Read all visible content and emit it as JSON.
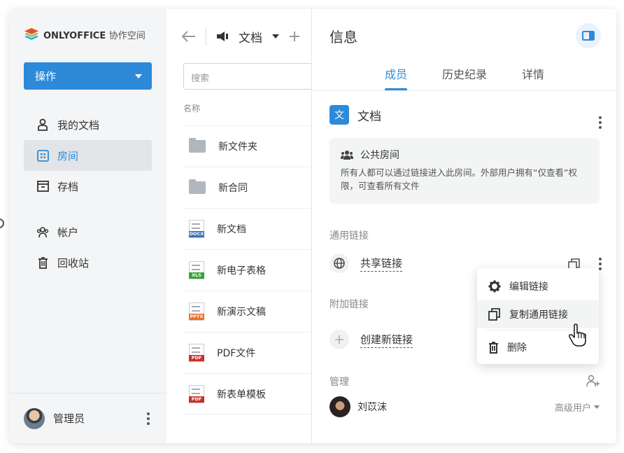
{
  "logo": {
    "brand": "ONLYOFFICE",
    "product": "协作空间"
  },
  "sidebar": {
    "action_label": "操作",
    "items": [
      {
        "label": "我的文档",
        "icon": "person-icon"
      },
      {
        "label": "房间",
        "icon": "rooms-icon",
        "active": true
      },
      {
        "label": "存档",
        "icon": "archive-icon"
      },
      {
        "label": "帐户",
        "icon": "accounts-icon"
      },
      {
        "label": "回收站",
        "icon": "trash-icon"
      }
    ],
    "user_name": "管理员"
  },
  "files": {
    "folder_title": "文档",
    "search_placeholder": "搜索",
    "column_name": "名称",
    "rows": [
      {
        "name": "新文件夹",
        "type": "folder"
      },
      {
        "name": "新合同",
        "type": "folder"
      },
      {
        "name": "新文档",
        "type": "docx",
        "tag": "DOCX",
        "color": "#3d6fb4"
      },
      {
        "name": "新电子表格",
        "type": "xls",
        "tag": "XLS",
        "color": "#3aa335"
      },
      {
        "name": "新演示文稿",
        "type": "pptx",
        "tag": "PPTX",
        "color": "#e6712f"
      },
      {
        "name": "PDF文件",
        "type": "pdf",
        "tag": "PDF",
        "color": "#c9302c"
      },
      {
        "name": "新表单模板",
        "type": "pdf",
        "tag": "PDF",
        "color": "#c9302c"
      }
    ]
  },
  "panel": {
    "title": "信息",
    "tabs": [
      "成员",
      "历史纪录",
      "详情"
    ],
    "room_icon_text": "文",
    "room_name": "文档",
    "public_room_title": "公共房间",
    "public_room_desc": "所有人都可以通过链接进入此房间。外部用户拥有“仅查看”权限，可查看所有文件",
    "general_links_label": "通用链接",
    "share_link_label": "共享链接",
    "additional_links_label": "附加链接",
    "create_link_label": "创建新链接",
    "manage_label": "管理",
    "member_name": "刘苡沫",
    "member_role": "高级用户"
  },
  "context_menu": {
    "items": [
      "编辑链接",
      "复制通用链接",
      "删除"
    ]
  },
  "colors": {
    "accent": "#2d8ad8",
    "sidebar_bg": "#f4f5f6"
  }
}
